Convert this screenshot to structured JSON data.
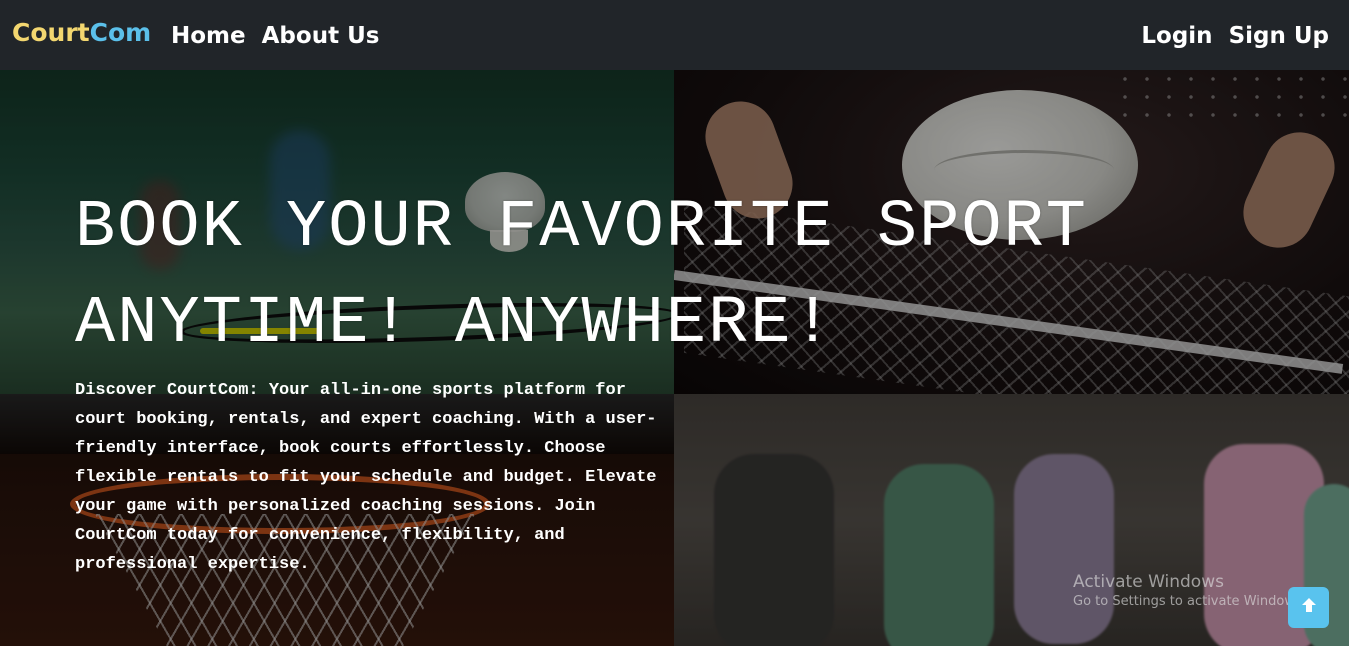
{
  "navbar": {
    "brand_part1": "Court",
    "brand_part2": "Com",
    "links_left": [
      "Home",
      "About Us"
    ],
    "links_right": [
      "Login",
      "Sign Up"
    ]
  },
  "hero": {
    "title_line1": "BOOK YOUR FAVORITE SPORT",
    "title_line2": "ANYTIME! ANYWHERE!",
    "description": "Discover CourtCom: Your all-in-one sports platform for court booking, rentals, and expert coaching. With a user-friendly interface, book courts effortlessly. Choose flexible rentals to fit your schedule and budget. Elevate your game with personalized coaching sessions. Join CourtCom today for convenience, flexibility, and professional expertise."
  },
  "watermark": {
    "title": "Activate Windows",
    "subtitle": "Go to Settings to activate Windows."
  },
  "icons": {
    "back_to_top": "arrow-up-icon"
  },
  "colors": {
    "navbar_bg": "#212529",
    "brand_court": "#f3d770",
    "brand_com": "#5bc0ea",
    "to_top_bg": "#59c3ee"
  }
}
